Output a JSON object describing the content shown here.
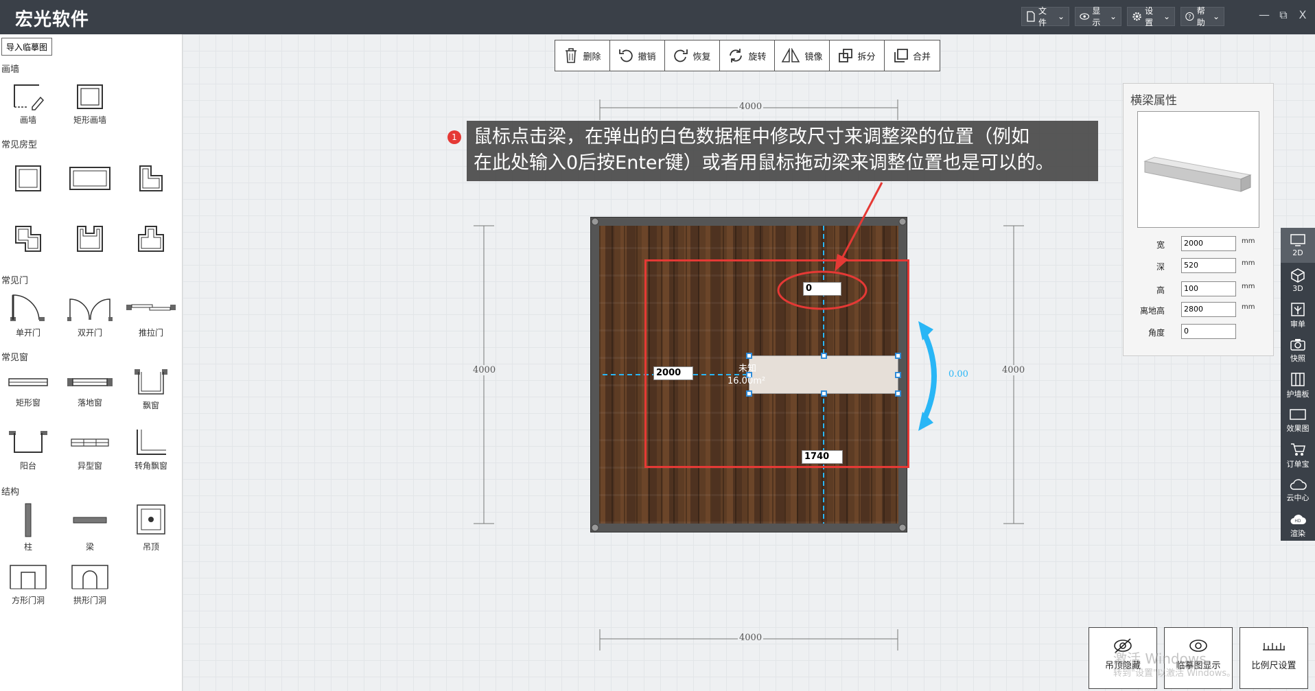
{
  "app": {
    "title": "宏光软件"
  },
  "top_menu": [
    {
      "label": "文件"
    },
    {
      "label": "显示"
    },
    {
      "label": "设置"
    },
    {
      "label": "帮助"
    }
  ],
  "window_controls": {
    "minimize": "—",
    "restore": "⧉",
    "close": "X"
  },
  "left_panel": {
    "import_button": "导入临摹图",
    "sections": {
      "draw_wall": {
        "title": "画墙",
        "items": [
          "画墙",
          "矩形画墙"
        ]
      },
      "room_types": {
        "title": "常见房型"
      },
      "doors": {
        "title": "常见门",
        "items": [
          "单开门",
          "双开门",
          "推拉门"
        ]
      },
      "windows": {
        "title": "常见窗",
        "items": [
          "矩形窗",
          "落地窗",
          "飘窗",
          "阳台",
          "异型窗",
          "转角飘窗"
        ]
      },
      "structure": {
        "title": "结构",
        "items": [
          "柱",
          "梁",
          "吊顶",
          "方形门洞",
          "拱形门洞"
        ]
      }
    }
  },
  "toolbar": [
    {
      "label": "删除",
      "icon": "trash-icon"
    },
    {
      "label": "撤销",
      "icon": "undo-icon"
    },
    {
      "label": "恢复",
      "icon": "redo-icon"
    },
    {
      "label": "旋转",
      "icon": "rotate-icon"
    },
    {
      "label": "镜像",
      "icon": "mirror-icon"
    },
    {
      "label": "拆分",
      "icon": "split-icon"
    },
    {
      "label": "合并",
      "icon": "merge-icon"
    }
  ],
  "callout": {
    "number": "1",
    "text_line1": "鼠标点击梁，在弹出的白色数据框中修改尺寸来调整梁的位置（例如",
    "text_line2": "在此处输入0后按Enter键）或者用鼠标拖动梁来调整位置也是可以的。"
  },
  "canvas": {
    "dims": {
      "top": "4000",
      "bottom": "4000",
      "left": "4000",
      "right": "4000"
    },
    "beam_inputs": {
      "top": "0",
      "left": "2000",
      "bottom": "1740"
    },
    "room_label": {
      "name": "未知",
      "area": "16.00m²"
    },
    "rotation_value": "0.00"
  },
  "properties": {
    "title": "横梁属性",
    "fields": [
      {
        "label": "宽",
        "value": "2000",
        "unit": "mm"
      },
      {
        "label": "深",
        "value": "520",
        "unit": "mm"
      },
      {
        "label": "高",
        "value": "100",
        "unit": "mm"
      },
      {
        "label": "离地高",
        "value": "2800",
        "unit": "mm"
      },
      {
        "label": "角度",
        "value": "0",
        "unit": ""
      }
    ]
  },
  "right_bar": [
    {
      "label": "2D",
      "icon": "2d-icon"
    },
    {
      "label": "3D",
      "icon": "3d-icon"
    },
    {
      "label": "审单",
      "icon": "review-icon"
    },
    {
      "label": "快照",
      "icon": "camera-icon"
    },
    {
      "label": "护墙板",
      "icon": "wall-panel-icon"
    },
    {
      "label": "效果图",
      "icon": "render-image-icon"
    },
    {
      "label": "订单宝",
      "icon": "cart-icon"
    },
    {
      "label": "云中心",
      "icon": "cloud-icon"
    },
    {
      "label": "渲染",
      "icon": "hd-render-icon"
    }
  ],
  "bottom_buttons": [
    {
      "label": "吊顶隐藏",
      "icon": "eye-off-icon"
    },
    {
      "label": "临摹图显示",
      "icon": "eye-icon"
    },
    {
      "label": "比例尺设置",
      "icon": "ruler-icon"
    }
  ],
  "watermark": {
    "line1": "激活 Windows",
    "line2": "转到\"设置\"以激活 Windows。"
  },
  "colors": {
    "topbar": "#3a4048",
    "accent_blue": "#29b6f6",
    "highlight_red": "#e53935"
  }
}
